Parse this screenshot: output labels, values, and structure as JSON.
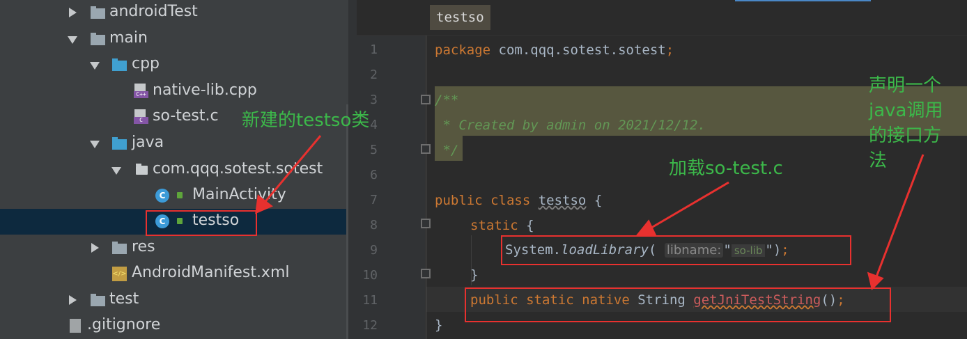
{
  "tree": {
    "items": [
      {
        "label": "androidTest",
        "expand": "collapsed",
        "icon": "folder-icon"
      },
      {
        "label": "main",
        "expand": "expanded",
        "icon": "folder-icon"
      },
      {
        "label": "cpp",
        "expand": "expanded",
        "icon": "folder-icon"
      },
      {
        "label": "native-lib.cpp",
        "icon": "cpp-file-icon"
      },
      {
        "label": "so-test.c",
        "icon": "c-file-icon"
      },
      {
        "label": "java",
        "expand": "expanded",
        "icon": "folder-icon"
      },
      {
        "label": "com.qqq.sotest.sotest",
        "expand": "expanded",
        "icon": "package-icon"
      },
      {
        "label": "MainActivity",
        "icon": "class-icon"
      },
      {
        "label": "testso",
        "icon": "class-icon",
        "selected": true
      },
      {
        "label": "res",
        "expand": "collapsed",
        "icon": "res-folder-icon"
      },
      {
        "label": "AndroidManifest.xml",
        "icon": "xml-file-icon"
      },
      {
        "label": "test",
        "expand": "collapsed",
        "icon": "folder-icon"
      },
      {
        "label": ".gitignore",
        "icon": "text-file-icon"
      }
    ],
    "cpp_icon_tag": "C++",
    "c_icon_tag": "C",
    "class_icon_letter": "C"
  },
  "editor": {
    "tab_label": "testso",
    "line_numbers": [
      "1",
      "2",
      "3",
      "4",
      "5",
      "6",
      "7",
      "8",
      "9",
      "10",
      "11",
      "12"
    ],
    "code": {
      "l1_kw": "package",
      "l1_rest": " com.qqq.sotest.sotest",
      "l1_semi": ";",
      "l3": "/**",
      "l4": " * Created by admin on 2021/12/12.",
      "l5": " */",
      "l7_kw": "public class",
      "l7_name": "testso",
      "l7_brace": " {",
      "l8_kw": "static",
      "l8_brace": " {",
      "l9_sys": "System.",
      "l9_method": "loadLibrary",
      "l9_paren": "(",
      "l9_hint": "libname:",
      "l9_q1": "\"",
      "l9_str": "so-lib",
      "l9_q2": "\"",
      "l9_close": ")",
      "l9_semi": ";",
      "l10": "}",
      "l11_kw": "public static native",
      "l11_type": " String ",
      "l11_method": "getJniTestString",
      "l11_paren": "()",
      "l11_semi": ";",
      "l12": "}"
    }
  },
  "annotations": {
    "new_class": "新建的testso类",
    "load_lib": "加载so-test.c",
    "declare_lines": [
      "声明一个",
      "java调用",
      "的接口方",
      "法"
    ]
  },
  "colors": {
    "annotation_red": "#e8312f",
    "annotation_green": "#3cb84a",
    "keyword": "#cc7832",
    "comment": "#629755"
  }
}
